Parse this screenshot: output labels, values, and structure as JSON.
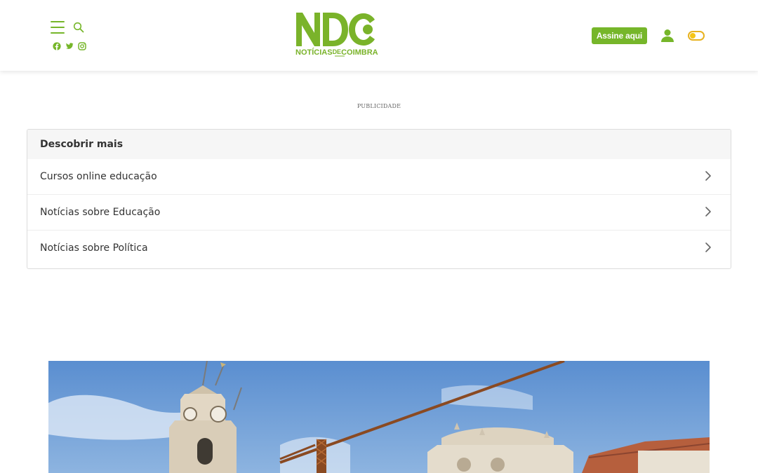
{
  "header": {
    "logo": {
      "main": "NDC",
      "tagline_pre": "NOTÍCIAS",
      "tagline_mid": "DE",
      "tagline_post": "COIMBRA"
    },
    "icons": [
      "menu-icon",
      "search-icon",
      "facebook-icon",
      "twitter-icon",
      "instagram-icon",
      "user-icon",
      "theme-toggle"
    ],
    "subscribe_label": "Assine aqui",
    "brand_color": "#76b62a",
    "toggle_color": "#f5c518"
  },
  "ad": {
    "label": "PUBLICIDADE"
  },
  "discover": {
    "title": "Descobrir mais",
    "items": [
      {
        "label": "Cursos online educação"
      },
      {
        "label": "Notícias sobre Educação"
      },
      {
        "label": "Notícias sobre Política"
      }
    ]
  }
}
